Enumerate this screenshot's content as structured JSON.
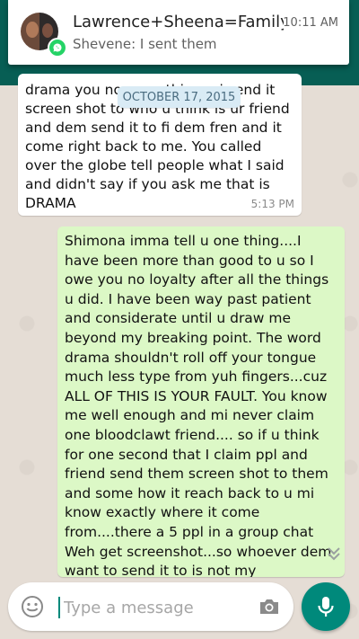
{
  "notification": {
    "title": "Lawrence+Sheena=Family..",
    "time": "10:11 AM",
    "snippet": "Shevene: I sent them",
    "app_icon": "whatsapp-icon"
  },
  "date_chip": "OCTOBER 17, 2015",
  "incoming_message": {
    "text": "drama you no                     everything mi send it screen shot to who u think is ur friend and dem send it to fi dem fren and it come right back to me. You called over the globe tell people what I said and didn't say if you ask me that is DRAMA",
    "time": "5:13 PM"
  },
  "outgoing_message": {
    "text": "Shimona imma tell u one thing....I have been more than good to u so I owe you no loyalty after all the things u did. I have been way past patient and considerate until u draw me beyond my breaking point. The word drama shouldn't roll off your tongue much less type from yuh fingers...cuz ALL OF THIS IS YOUR FAULT. You know me well enough and mi never claim one bloodclawt friend.... so if u think for one second that I claim ppl and friend send them screen shot to them and some how it reach back to u mi know exactly where it come from....there a 5 ppl in a group chat Weh get screenshot...so whoever dem want to send it to is not my problem....mi nuh have no secret fi"
  },
  "input": {
    "placeholder": "Type a message",
    "value": ""
  },
  "icons": {
    "emoji": "emoji-icon",
    "camera": "camera-icon",
    "mic": "mic-icon",
    "scroll": "chevron-double-down-icon"
  },
  "colors": {
    "header": "#075e54",
    "accent": "#00897b",
    "outgoing_bubble": "#dcf8c6",
    "incoming_bubble": "#ffffff",
    "chat_background": "#e5ddd5"
  }
}
